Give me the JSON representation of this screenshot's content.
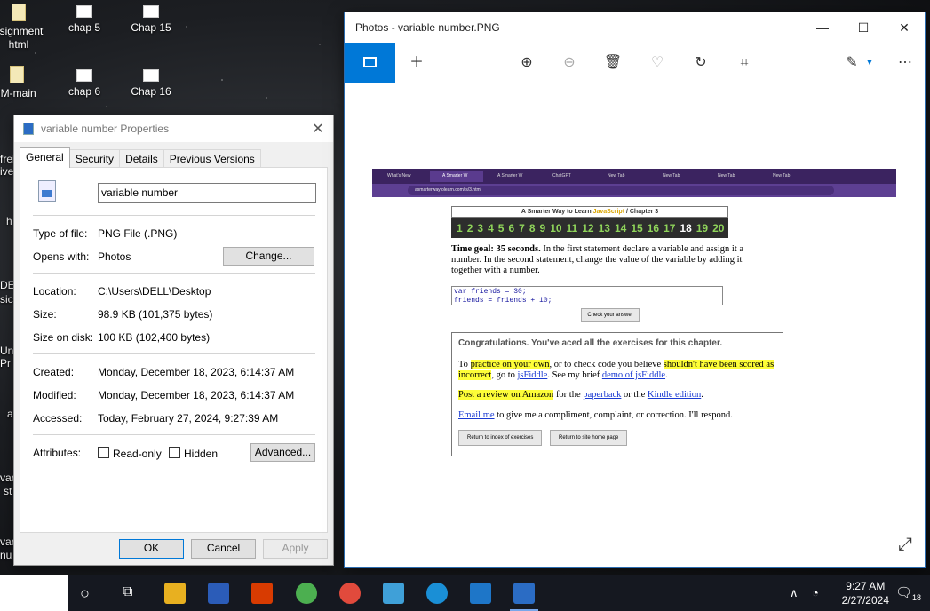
{
  "desktop": {
    "icons": [
      {
        "label": "ssignment\nhtml",
        "kind": "doc"
      },
      {
        "label": "chap 5",
        "kind": "file"
      },
      {
        "label": "Chap 15",
        "kind": "file"
      },
      {
        "label": "IM-main",
        "kind": "doc"
      },
      {
        "label": "chap 6",
        "kind": "file"
      },
      {
        "label": "Chap 16",
        "kind": "file"
      }
    ],
    "edge_labels": [
      "frei",
      "ive",
      "h",
      "DEN",
      "sics",
      "Un",
      "Pr",
      "a",
      "var",
      "st",
      "var",
      "nu"
    ]
  },
  "properties": {
    "title": "variable number Properties",
    "tabs": [
      "General",
      "Security",
      "Details",
      "Previous Versions"
    ],
    "filename": "variable number",
    "type_label": "Type of file:",
    "type_value": "PNG File (.PNG)",
    "opens_label": "Opens with:",
    "opens_value": "Photos",
    "change_button": "Change...",
    "location_label": "Location:",
    "location_value": "C:\\Users\\DELL\\Desktop",
    "size_label": "Size:",
    "size_value": "98.9 KB (101,375 bytes)",
    "sizeondisk_label": "Size on disk:",
    "sizeondisk_value": "100 KB (102,400 bytes)",
    "created_label": "Created:",
    "created_value": "Monday, December 18, 2023, 6:14:37 AM",
    "modified_label": "Modified:",
    "modified_value": "Monday, December 18, 2023, 6:14:37 AM",
    "accessed_label": "Accessed:",
    "accessed_value": "Today, February 27, 2024, 9:27:39 AM",
    "attributes_label": "Attributes:",
    "readonly_label": "Read-only",
    "hidden_label": "Hidden",
    "advanced_button": "Advanced...",
    "ok_button": "OK",
    "cancel_button": "Cancel",
    "apply_button": "Apply"
  },
  "photos": {
    "title": "Photos - variable number.PNG",
    "screenshot": {
      "browser_tabs": [
        "What's New",
        "A Smarter W",
        "A Smarter W",
        "ChatGPT",
        "New Tab",
        "New Tab",
        "New Tab",
        "New Tab"
      ],
      "url": "asmarterwaytolearn.com/js/3.html",
      "header_prefix": "A Smarter Way to Learn ",
      "header_js": "JavaScript",
      "header_suffix": " / Chapter 3",
      "numbers": [
        "1",
        "2",
        "3",
        "4",
        "5",
        "6",
        "7",
        "8",
        "9",
        "10",
        "11",
        "12",
        "13",
        "14",
        "15",
        "16",
        "17",
        "18",
        "19",
        "20"
      ],
      "current_number": "18",
      "goal_bold": "Time goal: 35 seconds.",
      "goal_text": " In the first statement declare a variable and assign it a number. In the second statement, change the value of the variable by adding it together with a number.",
      "code_line1": "var friends = 30;",
      "code_line2": "friends = friends + 10;",
      "check_button": "Check your answer",
      "congrats": "Congratulations. You've aced all the exercises for this chapter.",
      "p1_a": "To ",
      "p1_hl1": "practice on your own",
      "p1_b": ", or to check code you believe ",
      "p1_hl2": "shouldn't have been scored as incorrect",
      "p1_c": ", go to ",
      "p1_link1": "jsFiddle",
      "p1_d": ". See my brief ",
      "p1_link2": "demo of jsFiddle",
      "p1_e": ".",
      "p2_hl": "Post a review on Amazon",
      "p2_a": " for the ",
      "p2_link1": "paperback",
      "p2_b": " or the ",
      "p2_link2": "Kindle edition",
      "p2_c": ".",
      "p3_link": "Email me",
      "p3_text": " to give me a compliment, complaint, or correction. I'll respond.",
      "btn_index": "Return to index of exercises",
      "btn_home": "Return to site home page"
    }
  },
  "taskbar": {
    "time": "9:27 AM",
    "date": "2/27/2024",
    "notification_count": "18"
  }
}
